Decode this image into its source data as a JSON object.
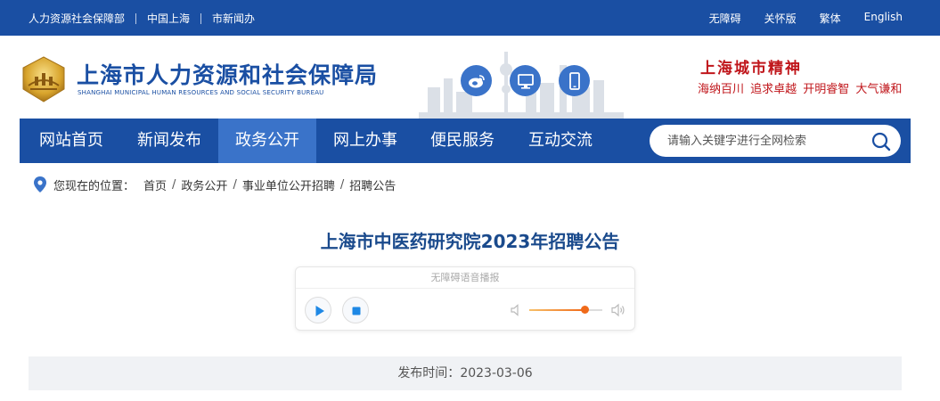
{
  "topbar": {
    "left_links": [
      "人力资源社会保障部",
      "中国上海",
      "市新闻办"
    ],
    "right_links": [
      "无障碍",
      "关怀版",
      "繁体",
      "English"
    ]
  },
  "header": {
    "title": "上海市人力资源和社会保障局",
    "subtitle": "SHANGHAI MUNICIPAL HUMAN RESOURCES AND SOCIAL SECURITY BUREAU",
    "social_icons": [
      "weibo-icon",
      "monitor-icon",
      "mobile-icon"
    ],
    "spirit_title": "上海城市精神",
    "spirit_motto": "海纳百川 追求卓越 开明睿智 大气谦和"
  },
  "nav": {
    "items": [
      "网站首页",
      "新闻发布",
      "政务公开",
      "网上办事",
      "便民服务",
      "互动交流"
    ],
    "active_index": 2,
    "search_placeholder": "请输入关键字进行全网检索"
  },
  "breadcrumb": {
    "label": "您现在的位置：",
    "items": [
      "首页",
      "政务公开",
      "事业单位公开招聘",
      "招聘公告"
    ]
  },
  "article": {
    "title": "上海市中医药研究院2023年招聘公告",
    "publish_label": "发布时间：",
    "publish_date": "2023-03-06"
  },
  "player": {
    "header": "无障碍语音播报",
    "volume": 0.76
  },
  "colors": {
    "brand_blue": "#1a4fa3",
    "nav_active": "#3a73c9",
    "spirit_red": "#c0161b",
    "title_blue": "#1a4a8c"
  }
}
